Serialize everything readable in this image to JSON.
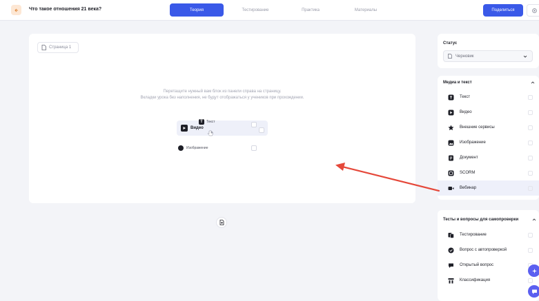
{
  "header": {
    "title": "Что такое отношения 21 века?",
    "tabs": [
      {
        "label": "Теория",
        "active": true
      },
      {
        "label": "Тестирование",
        "active": false
      },
      {
        "label": "Практика",
        "active": false
      },
      {
        "label": "Материалы",
        "active": false
      }
    ],
    "publish_label": "Поделиться"
  },
  "canvas": {
    "page_label": "Страница 1",
    "hint_line1": "Перетащите нужный вам блок из панели справа на страницу.",
    "hint_line2": "Вкладки урока без наполнения, не будут отображаться у учеников при прохождении.",
    "drag_ghost_label": "Текст",
    "drop_item_label": "Видео",
    "image_item_label": "Изображение"
  },
  "status_panel": {
    "title": "Статус",
    "value": "Черновик"
  },
  "media_panel": {
    "title": "Медиа и текст",
    "items": [
      {
        "label": "Текст",
        "icon": "text-icon"
      },
      {
        "label": "Видео",
        "icon": "video-icon"
      },
      {
        "label": "Внешние сервисы",
        "icon": "external-services-icon"
      },
      {
        "label": "Изображение",
        "icon": "image-icon"
      },
      {
        "label": "Документ",
        "icon": "document-icon"
      },
      {
        "label": "SCORM",
        "icon": "scorm-icon"
      },
      {
        "label": "Вебинар",
        "icon": "webinar-icon"
      }
    ]
  },
  "tests_panel": {
    "title": "Тесты и вопросы для самопроверки",
    "items": [
      {
        "label": "Тестирование",
        "icon": "testing-icon"
      },
      {
        "label": "Вопрос с автопроверкой",
        "icon": "auto-check-icon"
      },
      {
        "label": "Открытый вопрос",
        "icon": "open-question-icon"
      },
      {
        "label": "Классификация",
        "icon": "classification-icon"
      }
    ]
  },
  "colors": {
    "accent": "#3a59e8",
    "arrow": "#e5483a",
    "fab": "#5b5ff0"
  }
}
